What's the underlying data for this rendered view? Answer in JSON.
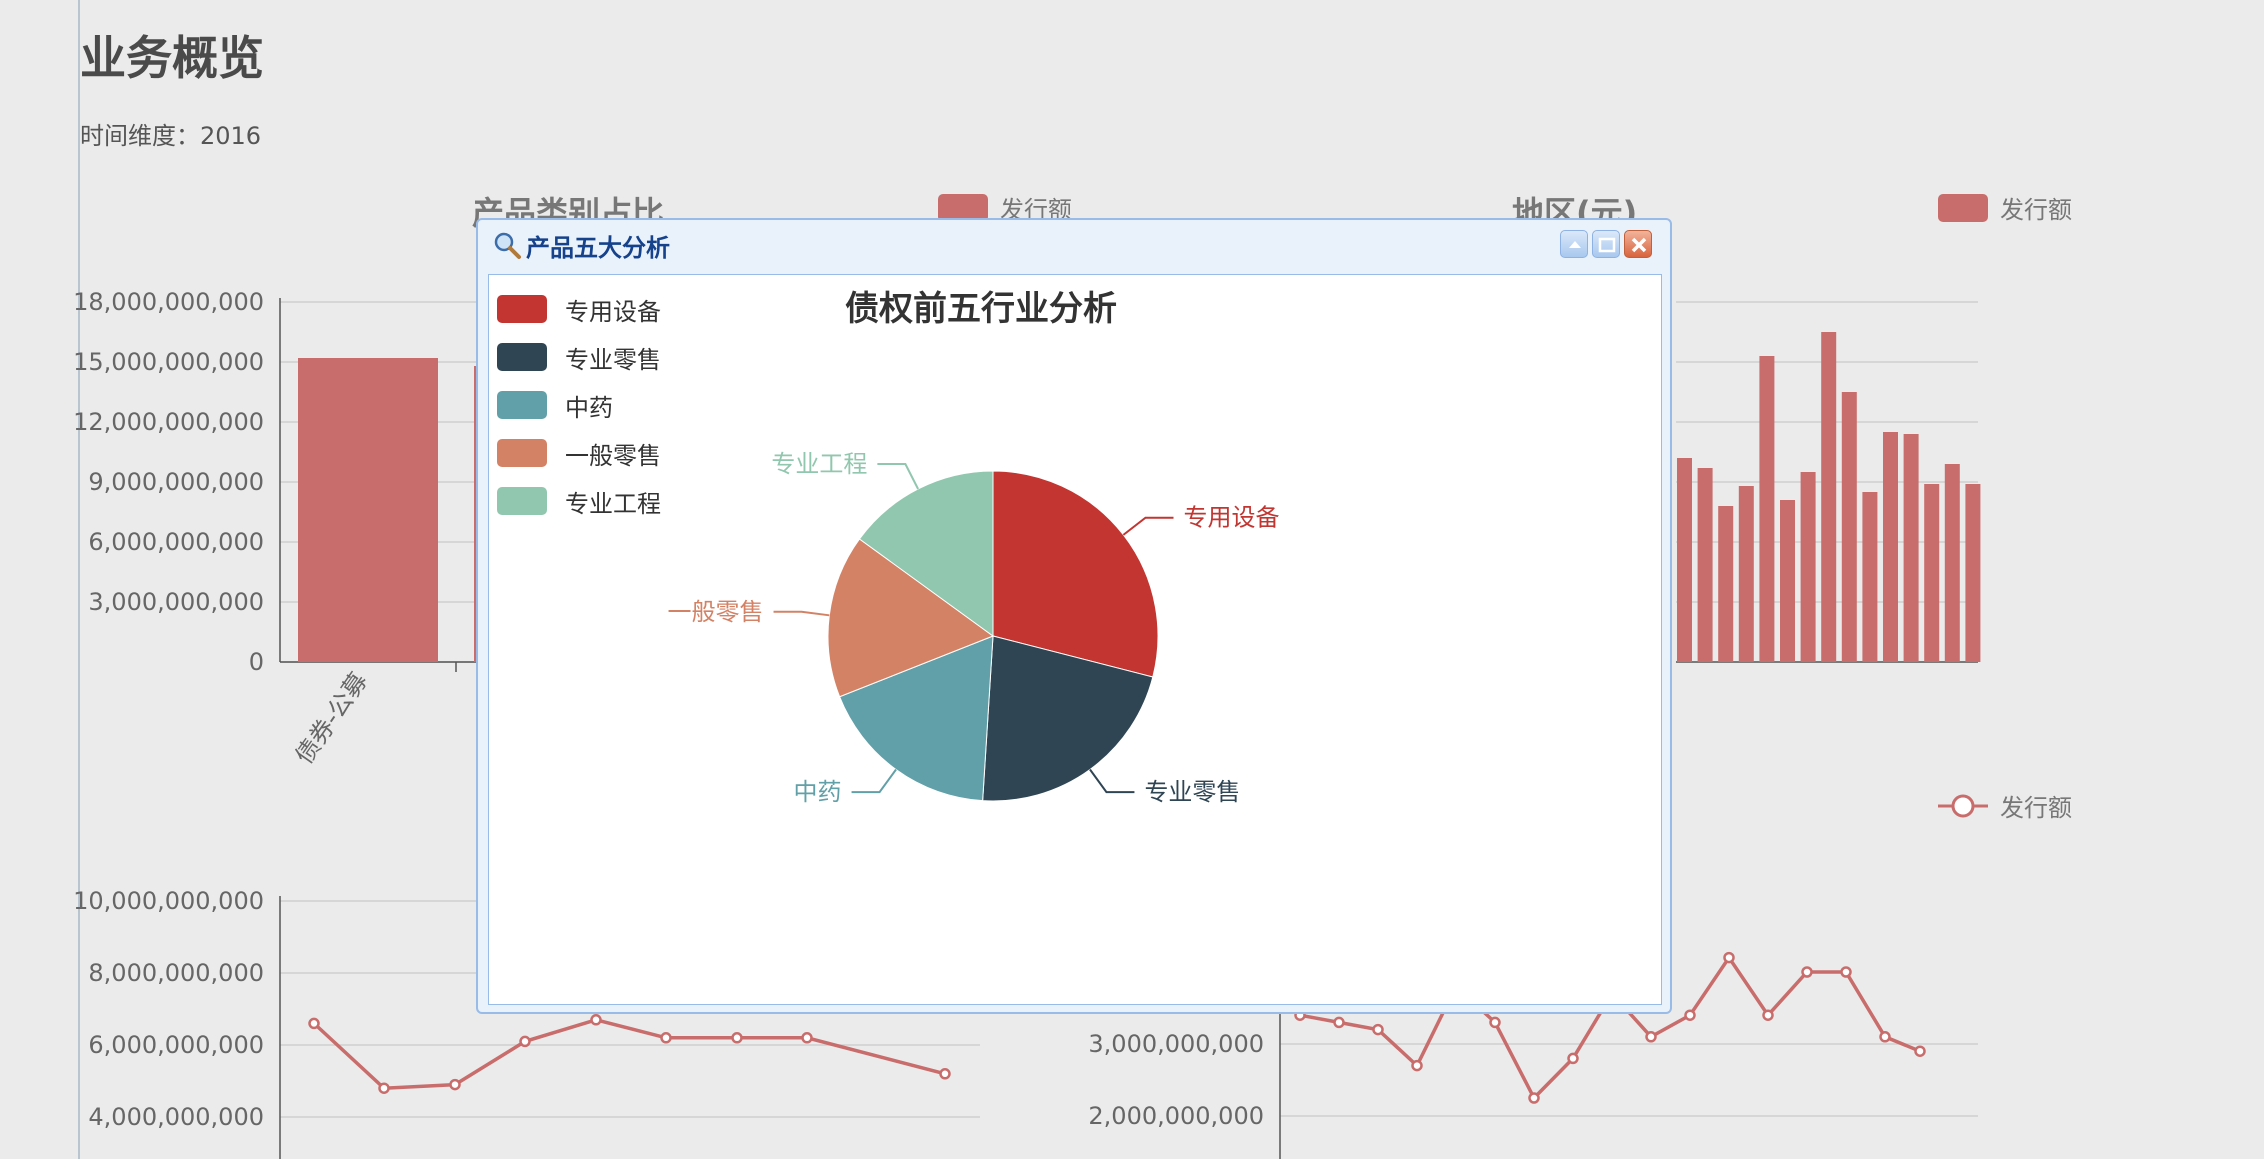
{
  "page": {
    "title": "业务概览",
    "time_dimension_label": "时间维度：",
    "time_dimension_value": "2016"
  },
  "colors": {
    "series": "#c86d6b",
    "dialog_border": "#99bbe8",
    "dialog_title": "#15428b"
  },
  "charts": {
    "product_category": {
      "title": "产品类别占比",
      "legend": "发行额",
      "y_ticks": [
        "18,000,000,000",
        "15,000,000,000",
        "12,000,000,000",
        "9,000,000,000",
        "6,000,000,000",
        "3,000,000,000",
        "0"
      ],
      "first_category_label": "债券-公募"
    },
    "region": {
      "title": "地区(元)",
      "legend": "发行额"
    },
    "trend_left": {
      "y_ticks": [
        "10,000,000,000",
        "8,000,000,000",
        "6,000,000,000",
        "4,000,000,000"
      ]
    },
    "trend_right": {
      "legend": "发行额",
      "y_ticks": [
        "3,000,000,000",
        "2,000,000,000"
      ]
    }
  },
  "chart_data": [
    {
      "type": "bar",
      "title": "产品类别占比",
      "series": [
        {
          "name": "发行额",
          "values": [
            15200000000,
            14800000000
          ]
        }
      ],
      "categories": [
        "债券-公募"
      ],
      "ylim": [
        0,
        18000000000
      ]
    },
    {
      "type": "bar",
      "title": "地区(元)",
      "series": [
        {
          "name": "发行额",
          "values": [
            10200000000,
            9700000000,
            7800000000,
            8800000000,
            15300000000,
            8100000000,
            9500000000,
            16500000000,
            13500000000,
            8500000000,
            11500000000,
            11400000000,
            8900000000,
            9900000000,
            8900000000
          ]
        }
      ],
      "ylim": [
        0,
        18000000000
      ]
    },
    {
      "type": "line",
      "series": [
        {
          "name": "发行额",
          "values": [
            6600000000,
            4800000000,
            4900000000,
            6100000000,
            6700000000,
            6200000000,
            6200000000,
            6200000000,
            5200000000
          ]
        }
      ],
      "ylim": [
        4000000000,
        10000000000
      ]
    },
    {
      "type": "line",
      "series": [
        {
          "name": "发行额",
          "values": [
            3400000000,
            3300000000,
            3200000000,
            2700000000,
            3800000000,
            3300000000,
            2250000000,
            2800000000,
            3700000000,
            3100000000,
            3400000000,
            4200000000,
            3400000000,
            4000000000,
            4000000000,
            3100000000,
            2900000000
          ]
        }
      ],
      "ylim": [
        2000000000,
        3000000000
      ]
    },
    {
      "type": "pie",
      "title": "债权前五行业分析",
      "categories": [
        "专用设备",
        "专业零售",
        "中药",
        "一般零售",
        "专业工程"
      ],
      "values": [
        29,
        22,
        18,
        16,
        15
      ],
      "colors": [
        "#c23531",
        "#2f4554",
        "#61a0a8",
        "#d48265",
        "#91c7ae"
      ]
    }
  ],
  "dialog": {
    "title": "产品五大分析",
    "icon": "magnifier-icon",
    "tools": [
      "collapse-icon",
      "maximize-icon",
      "close-icon"
    ]
  }
}
